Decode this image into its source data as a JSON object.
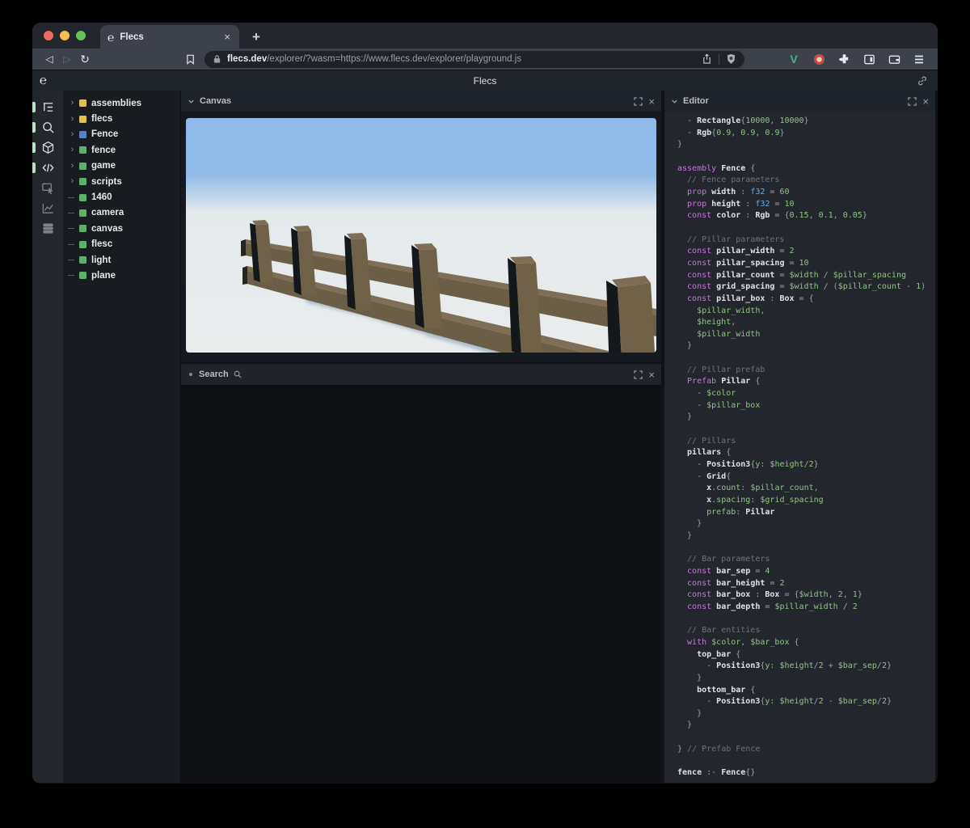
{
  "browser": {
    "tab_title": "Flecs",
    "close_tab_label": "×",
    "new_tab_label": "+",
    "back_label": "◁",
    "forward_label": "▷",
    "reload_label": "↻",
    "url_domain": "flecs.dev",
    "url_path": "/explorer/?wasm=https://www.flecs.dev/explorer/playground.js",
    "traffic_lights": {
      "close": "#ee6a5f",
      "minimize": "#f5bd4f",
      "zoom": "#61c454"
    },
    "toolbar_icons": [
      "back-icon",
      "forward-icon",
      "reload-icon",
      "bookmark-icon",
      "lock-icon",
      "share-icon",
      "brave-shield-icon",
      "vue-devtools-icon",
      "extension-badge-icon",
      "extensions-puzzle-icon",
      "sidebar-icon",
      "wallet-icon",
      "menu-icon"
    ]
  },
  "header": {
    "title": "Flecs",
    "logo": "℮",
    "icons": [
      "flecs-logo-icon",
      "link-icon"
    ]
  },
  "sidebar": {
    "accent_color": "#b9e2c4",
    "icons": [
      {
        "name": "outliner-icon",
        "active": true
      },
      {
        "name": "search-icon",
        "active": true
      },
      {
        "name": "scene-cube-icon",
        "active": true
      },
      {
        "name": "code-icon",
        "active": true
      },
      {
        "name": "inspector-icon",
        "active": false
      },
      {
        "name": "stats-chart-icon",
        "active": false
      },
      {
        "name": "rows-icon",
        "active": false
      }
    ]
  },
  "tree": {
    "items": [
      {
        "label": "assemblies",
        "color": "#e2c24b",
        "expandable": true
      },
      {
        "label": "flecs",
        "color": "#e2c24b",
        "expandable": true
      },
      {
        "label": "Fence",
        "color": "#5b80c4",
        "expandable": true
      },
      {
        "label": "fence",
        "color": "#5cb06a",
        "expandable": true
      },
      {
        "label": "game",
        "color": "#5cb06a",
        "expandable": true
      },
      {
        "label": "scripts",
        "color": "#5cb06a",
        "expandable": true
      },
      {
        "label": "1460",
        "color": "#5cb06a",
        "expandable": false
      },
      {
        "label": "camera",
        "color": "#5cb06a",
        "expandable": false
      },
      {
        "label": "canvas",
        "color": "#5cb06a",
        "expandable": false
      },
      {
        "label": "flesc",
        "color": "#5cb06a",
        "expandable": false
      },
      {
        "label": "light",
        "color": "#5cb06a",
        "expandable": false
      },
      {
        "label": "plane",
        "color": "#5cb06a",
        "expandable": false
      }
    ]
  },
  "panels": {
    "canvas": {
      "title": "Canvas"
    },
    "search": {
      "title": "Search"
    },
    "editor": {
      "title": "Editor"
    }
  },
  "scene": {
    "description": "3D render of wooden fence with 6 pillars and two rails on white ground under blue sky",
    "sky_color": "#8fb9e8",
    "ground_color": "#e9ebec",
    "wood_front": "#6c5f48",
    "wood_top": "#7d6e54",
    "wood_side": "#15181b",
    "shadow_color": "#8da5ba"
  },
  "editor": {
    "lines": [
      [
        [
          "p",
          "  - "
        ],
        [
          "i",
          "Rectangle"
        ],
        [
          "p",
          "{"
        ],
        [
          "v",
          "10000"
        ],
        [
          "p",
          ", "
        ],
        [
          "v",
          "10000"
        ],
        [
          "p",
          "}"
        ]
      ],
      [
        [
          "p",
          "  - "
        ],
        [
          "i",
          "Rgb"
        ],
        [
          "p",
          "{"
        ],
        [
          "v",
          "0.9"
        ],
        [
          "p",
          ", "
        ],
        [
          "v",
          "0.9"
        ],
        [
          "p",
          ", "
        ],
        [
          "v",
          "0.9"
        ],
        [
          "p",
          "}"
        ]
      ],
      [
        [
          "p",
          "}"
        ]
      ],
      [],
      [
        [
          "k",
          "assembly "
        ],
        [
          "i",
          "Fence "
        ],
        [
          "p",
          "{"
        ]
      ],
      [
        [
          "c",
          "  // Fence parameters"
        ]
      ],
      [
        [
          "k",
          "  prop "
        ],
        [
          "i",
          "width "
        ],
        [
          "p",
          ": "
        ],
        [
          "b",
          "f32 "
        ],
        [
          "p",
          "= "
        ],
        [
          "v",
          "60"
        ]
      ],
      [
        [
          "k",
          "  prop "
        ],
        [
          "i",
          "height "
        ],
        [
          "p",
          ": "
        ],
        [
          "b",
          "f32 "
        ],
        [
          "p",
          "= "
        ],
        [
          "v",
          "10"
        ]
      ],
      [
        [
          "k",
          "  const "
        ],
        [
          "i",
          "color "
        ],
        [
          "p",
          ": "
        ],
        [
          "i",
          "Rgb "
        ],
        [
          "p",
          "= {"
        ],
        [
          "v",
          "0.15"
        ],
        [
          "p",
          ", "
        ],
        [
          "v",
          "0.1"
        ],
        [
          "p",
          ", "
        ],
        [
          "v",
          "0.05"
        ],
        [
          "p",
          "}"
        ]
      ],
      [],
      [
        [
          "c",
          "  // Pillar parameters"
        ]
      ],
      [
        [
          "k",
          "  const "
        ],
        [
          "i",
          "pillar_width "
        ],
        [
          "p",
          "= "
        ],
        [
          "v",
          "2"
        ]
      ],
      [
        [
          "k",
          "  const "
        ],
        [
          "i",
          "pillar_spacing "
        ],
        [
          "p",
          "= "
        ],
        [
          "v",
          "10"
        ]
      ],
      [
        [
          "k",
          "  const "
        ],
        [
          "i",
          "pillar_count "
        ],
        [
          "p",
          "= "
        ],
        [
          "v",
          "$width"
        ],
        [
          "p",
          " / "
        ],
        [
          "v",
          "$pillar_spacing"
        ]
      ],
      [
        [
          "k",
          "  const "
        ],
        [
          "i",
          "grid_spacing "
        ],
        [
          "p",
          "= "
        ],
        [
          "v",
          "$width"
        ],
        [
          "p",
          " / ("
        ],
        [
          "v",
          "$pillar_count"
        ],
        [
          "p",
          " - "
        ],
        [
          "v",
          "1"
        ],
        [
          "p",
          ")"
        ]
      ],
      [
        [
          "k",
          "  const "
        ],
        [
          "i",
          "pillar_box "
        ],
        [
          "p",
          ": "
        ],
        [
          "i",
          "Box "
        ],
        [
          "p",
          "= {"
        ]
      ],
      [
        [
          "v",
          "    $pillar_width"
        ],
        [
          "p",
          ","
        ]
      ],
      [
        [
          "v",
          "    $height"
        ],
        [
          "p",
          ","
        ]
      ],
      [
        [
          "v",
          "    $pillar_width"
        ]
      ],
      [
        [
          "p",
          "  }"
        ]
      ],
      [],
      [
        [
          "c",
          "  // Pillar prefab"
        ]
      ],
      [
        [
          "k",
          "  Prefab "
        ],
        [
          "i",
          "Pillar "
        ],
        [
          "p",
          "{"
        ]
      ],
      [
        [
          "p",
          "    - "
        ],
        [
          "v",
          "$color"
        ]
      ],
      [
        [
          "p",
          "    - "
        ],
        [
          "v",
          "$pillar_box"
        ]
      ],
      [
        [
          "p",
          "  }"
        ]
      ],
      [],
      [
        [
          "c",
          "  // Pillars"
        ]
      ],
      [
        [
          "i",
          "  pillars "
        ],
        [
          "p",
          "{"
        ]
      ],
      [
        [
          "p",
          "    - "
        ],
        [
          "i",
          "Position3"
        ],
        [
          "p",
          "{"
        ],
        [
          "v",
          "y"
        ],
        [
          "p",
          ": "
        ],
        [
          "v",
          "$height"
        ],
        [
          "p",
          "/"
        ],
        [
          "v",
          "2"
        ],
        [
          "p",
          "}"
        ]
      ],
      [
        [
          "p",
          "    - "
        ],
        [
          "i",
          "Grid"
        ],
        [
          "p",
          "{"
        ]
      ],
      [
        [
          "i",
          "      x"
        ],
        [
          "p",
          "."
        ],
        [
          "v",
          "count"
        ],
        [
          "p",
          ": "
        ],
        [
          "v",
          "$pillar_count"
        ],
        [
          "p",
          ","
        ]
      ],
      [
        [
          "i",
          "      x"
        ],
        [
          "p",
          "."
        ],
        [
          "v",
          "spacing"
        ],
        [
          "p",
          ": "
        ],
        [
          "v",
          "$grid_spacing"
        ]
      ],
      [
        [
          "v",
          "      prefab"
        ],
        [
          "p",
          ": "
        ],
        [
          "i",
          "Pillar"
        ]
      ],
      [
        [
          "p",
          "    }"
        ]
      ],
      [
        [
          "p",
          "  }"
        ]
      ],
      [],
      [
        [
          "c",
          "  // Bar parameters"
        ]
      ],
      [
        [
          "k",
          "  const "
        ],
        [
          "i",
          "bar_sep "
        ],
        [
          "p",
          "= "
        ],
        [
          "v",
          "4"
        ]
      ],
      [
        [
          "k",
          "  const "
        ],
        [
          "i",
          "bar_height "
        ],
        [
          "p",
          "= "
        ],
        [
          "v",
          "2"
        ]
      ],
      [
        [
          "k",
          "  const "
        ],
        [
          "i",
          "bar_box "
        ],
        [
          "p",
          ": "
        ],
        [
          "i",
          "Box "
        ],
        [
          "p",
          "= {"
        ],
        [
          "v",
          "$width"
        ],
        [
          "p",
          ", "
        ],
        [
          "v",
          "2"
        ],
        [
          "p",
          ", "
        ],
        [
          "v",
          "1"
        ],
        [
          "p",
          "}"
        ]
      ],
      [
        [
          "k",
          "  const "
        ],
        [
          "i",
          "bar_depth "
        ],
        [
          "p",
          "= "
        ],
        [
          "v",
          "$pillar_width"
        ],
        [
          "p",
          " / "
        ],
        [
          "v",
          "2"
        ]
      ],
      [],
      [
        [
          "c",
          "  // Bar entities"
        ]
      ],
      [
        [
          "k",
          "  with "
        ],
        [
          "v",
          "$color"
        ],
        [
          "p",
          ", "
        ],
        [
          "v",
          "$bar_box "
        ],
        [
          "p",
          "{"
        ]
      ],
      [
        [
          "i",
          "    top_bar "
        ],
        [
          "p",
          "{"
        ]
      ],
      [
        [
          "p",
          "      - "
        ],
        [
          "i",
          "Position3"
        ],
        [
          "p",
          "{"
        ],
        [
          "v",
          "y"
        ],
        [
          "p",
          ": "
        ],
        [
          "v",
          "$height"
        ],
        [
          "p",
          "/"
        ],
        [
          "v",
          "2"
        ],
        [
          "p",
          " + "
        ],
        [
          "v",
          "$bar_sep"
        ],
        [
          "p",
          "/"
        ],
        [
          "v",
          "2"
        ],
        [
          "p",
          "}"
        ]
      ],
      [
        [
          "p",
          "    }"
        ]
      ],
      [
        [
          "i",
          "    bottom_bar "
        ],
        [
          "p",
          "{"
        ]
      ],
      [
        [
          "p",
          "      - "
        ],
        [
          "i",
          "Position3"
        ],
        [
          "p",
          "{"
        ],
        [
          "v",
          "y"
        ],
        [
          "p",
          ": "
        ],
        [
          "v",
          "$height"
        ],
        [
          "p",
          "/"
        ],
        [
          "v",
          "2"
        ],
        [
          "p",
          " - "
        ],
        [
          "v",
          "$bar_sep"
        ],
        [
          "p",
          "/"
        ],
        [
          "v",
          "2"
        ],
        [
          "p",
          "}"
        ]
      ],
      [
        [
          "p",
          "    }"
        ]
      ],
      [
        [
          "p",
          "  }"
        ]
      ],
      [],
      [
        [
          "p",
          "} "
        ],
        [
          "c",
          "// Prefab Fence"
        ]
      ],
      [],
      [
        [
          "i",
          "fence "
        ],
        [
          "p",
          ":- "
        ],
        [
          "i",
          "Fence"
        ],
        [
          "p",
          "{}"
        ]
      ]
    ]
  }
}
